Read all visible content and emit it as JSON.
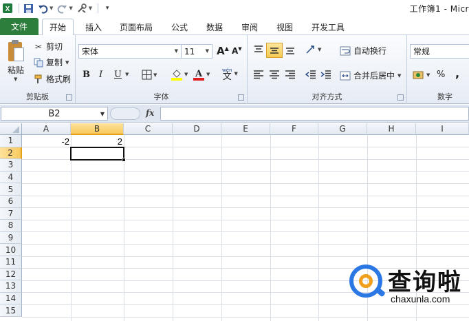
{
  "window": {
    "title": "工作簿1 - Micr"
  },
  "quick_access": {
    "icons": [
      "excel-icon",
      "save-icon",
      "undo-icon",
      "redo-icon",
      "customize-icon"
    ]
  },
  "tabs": [
    "文件",
    "开始",
    "插入",
    "页面布局",
    "公式",
    "数据",
    "审阅",
    "视图",
    "开发工具"
  ],
  "active_tab": "开始",
  "clipboard": {
    "paste_label": "粘贴",
    "cut_label": "剪切",
    "copy_label": "复制",
    "format_painter_label": "格式刷",
    "group_label": "剪贴板"
  },
  "font": {
    "name": "宋体",
    "size": "11",
    "grow_label": "A",
    "shrink_label": "A",
    "bold_label": "B",
    "italic_label": "I",
    "underline_label": "U",
    "phonetic_label": "wén",
    "group_label": "字体"
  },
  "alignment": {
    "wrap_label": "自动换行",
    "merge_label": "合并后居中",
    "group_label": "对齐方式"
  },
  "number": {
    "format": "常规",
    "percent_label": "%",
    "comma_label": ",",
    "group_label": "数字"
  },
  "formula_bar": {
    "name_box": "B2",
    "fx_label": "fx",
    "value": ""
  },
  "sheet": {
    "columns": [
      "A",
      "B",
      "C",
      "D",
      "E",
      "F",
      "G",
      "H",
      "I"
    ],
    "rows": [
      "1",
      "2",
      "3",
      "4",
      "5",
      "6",
      "7",
      "8",
      "9",
      "10",
      "11",
      "12",
      "13",
      "14",
      "15"
    ],
    "selected_cell": "B2",
    "cells": {
      "A1": "-2",
      "B1": "2"
    }
  },
  "watermark": {
    "cn": "查询啦",
    "en": "chaxunla.com"
  },
  "colors": {
    "file_tab": "#2d7d3c",
    "selection_header": "#f9c95f",
    "accent": "#2b78e4"
  }
}
